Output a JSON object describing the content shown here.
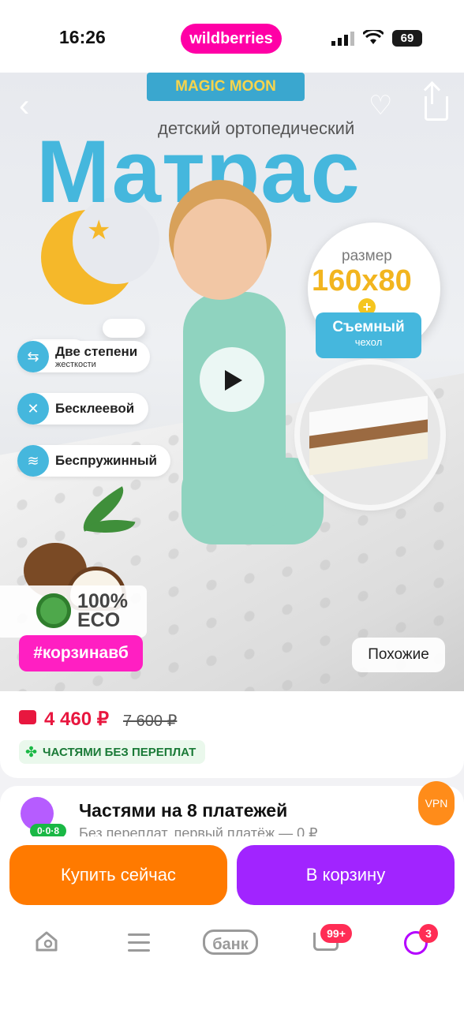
{
  "status_bar": {
    "time": "16:26",
    "battery": "69"
  },
  "header": {
    "brand": "wildberries"
  },
  "hero": {
    "brand_banner": "MAGIC MOON",
    "subtitle": "детский ортопедический",
    "title": "Матрас",
    "size_label": "размер",
    "size_value": "160x80",
    "plus": "+",
    "cover_title": "Съемный",
    "cover_subtitle": "чехол",
    "features": [
      {
        "label": "Две степени",
        "sublabel": "жесткости"
      },
      {
        "label": "Бесклеевой"
      },
      {
        "label": "Беспружинный"
      }
    ],
    "eco_percent": "100%",
    "eco_label": "ECO",
    "hashtag": "#корзинавб",
    "similar_button": "Похожие"
  },
  "price": {
    "current": "4 460 ₽",
    "old": "7 600 ₽",
    "installments_badge": "ЧАСТЯМИ БЕЗ ПЕРЕПЛАТ"
  },
  "installments": {
    "title": "Частями на 8 платежей",
    "subtitle": "Без переплат, первый платёж — 0 ₽",
    "badge": "0·0·8"
  },
  "vpn_button": "VPN",
  "actions": {
    "buy_now": "Купить сейчас",
    "add_to_cart": "В корзину"
  },
  "tabbar": {
    "bank": "банк",
    "cart_count": "99+",
    "profile_count": "3"
  },
  "colors": {
    "brand": "#ff00a6",
    "price": "#e8173f",
    "buy": "#ff7a00",
    "cart": "#a124ff",
    "accent": "#45b7dd"
  }
}
